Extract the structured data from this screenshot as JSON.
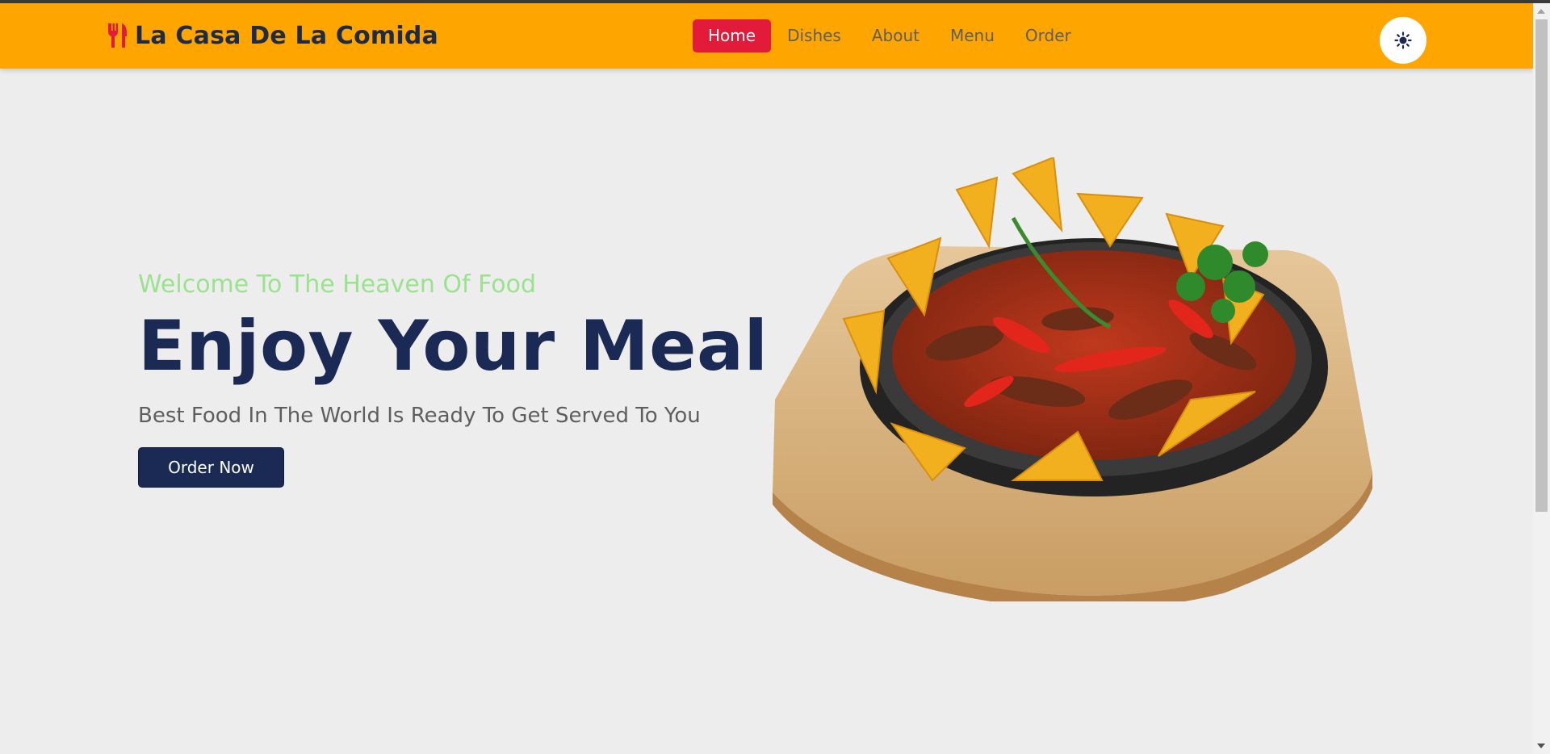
{
  "brand": {
    "name": "La Casa De La Comida",
    "icon": "utensils-icon",
    "color": "#e21b3a"
  },
  "nav": {
    "items": [
      {
        "label": "Home",
        "active": true
      },
      {
        "label": "Dishes",
        "active": false
      },
      {
        "label": "About",
        "active": false
      },
      {
        "label": "Menu",
        "active": false
      },
      {
        "label": "Order",
        "active": false
      }
    ]
  },
  "theme_toggle": {
    "icon": "sun-icon"
  },
  "hero": {
    "welcome": "Welcome To The Heaven Of Food",
    "headline": "Enjoy Your Meal",
    "subtitle": "Best Food In The World Is Ready To Get Served To You",
    "cta_label": "Order Now",
    "image": "sizzling-fajita-skillet-image"
  },
  "colors": {
    "navbar": "#ffa500",
    "accent": "#e21b3a",
    "primary": "#1b2a55",
    "welcome": "#9be28f",
    "background": "#ededed"
  }
}
